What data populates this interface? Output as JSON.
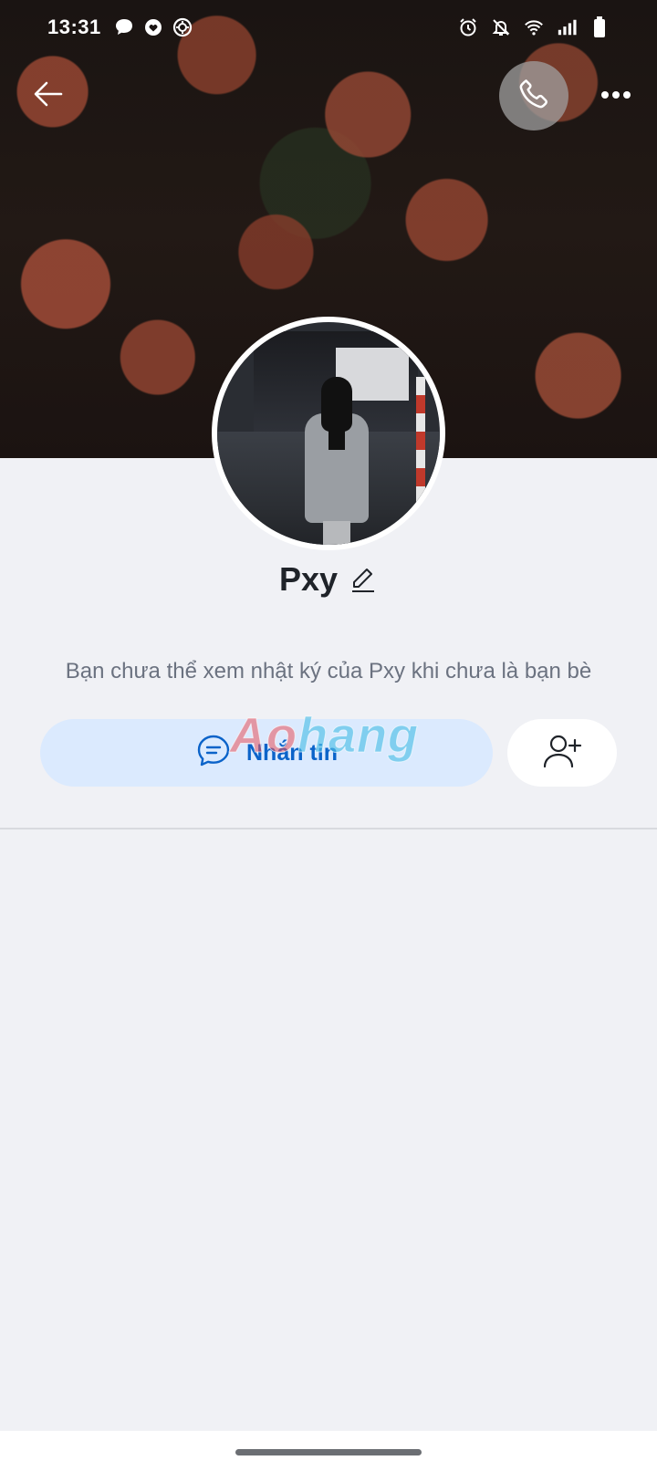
{
  "status_bar": {
    "time": "13:31",
    "left_icons": [
      "message-bubble-icon",
      "heart-chat-icon",
      "settings-gear-icon"
    ],
    "right_icons": [
      "alarm-icon",
      "bell-off-icon",
      "wifi-icon",
      "signal-icon",
      "battery-icon"
    ]
  },
  "header": {
    "back_icon": "arrow-left-icon",
    "call_icon": "phone-icon",
    "more_icon": "more-horizontal-icon"
  },
  "profile": {
    "name": "Pxy",
    "edit_icon": "pencil-icon",
    "notice": "Bạn chưa thể xem nhật ký của Pxy khi chưa là bạn bè"
  },
  "actions": {
    "message_label": "Nhắn tin",
    "message_icon": "chat-bubble-icon",
    "add_friend_icon": "user-plus-icon"
  },
  "watermark": {
    "text_red": "Ao",
    "text_blue": "hang"
  },
  "colors": {
    "accent": "#0b63c9",
    "message_button_bg": "#dbeafe",
    "background": "#f0f1f5"
  }
}
